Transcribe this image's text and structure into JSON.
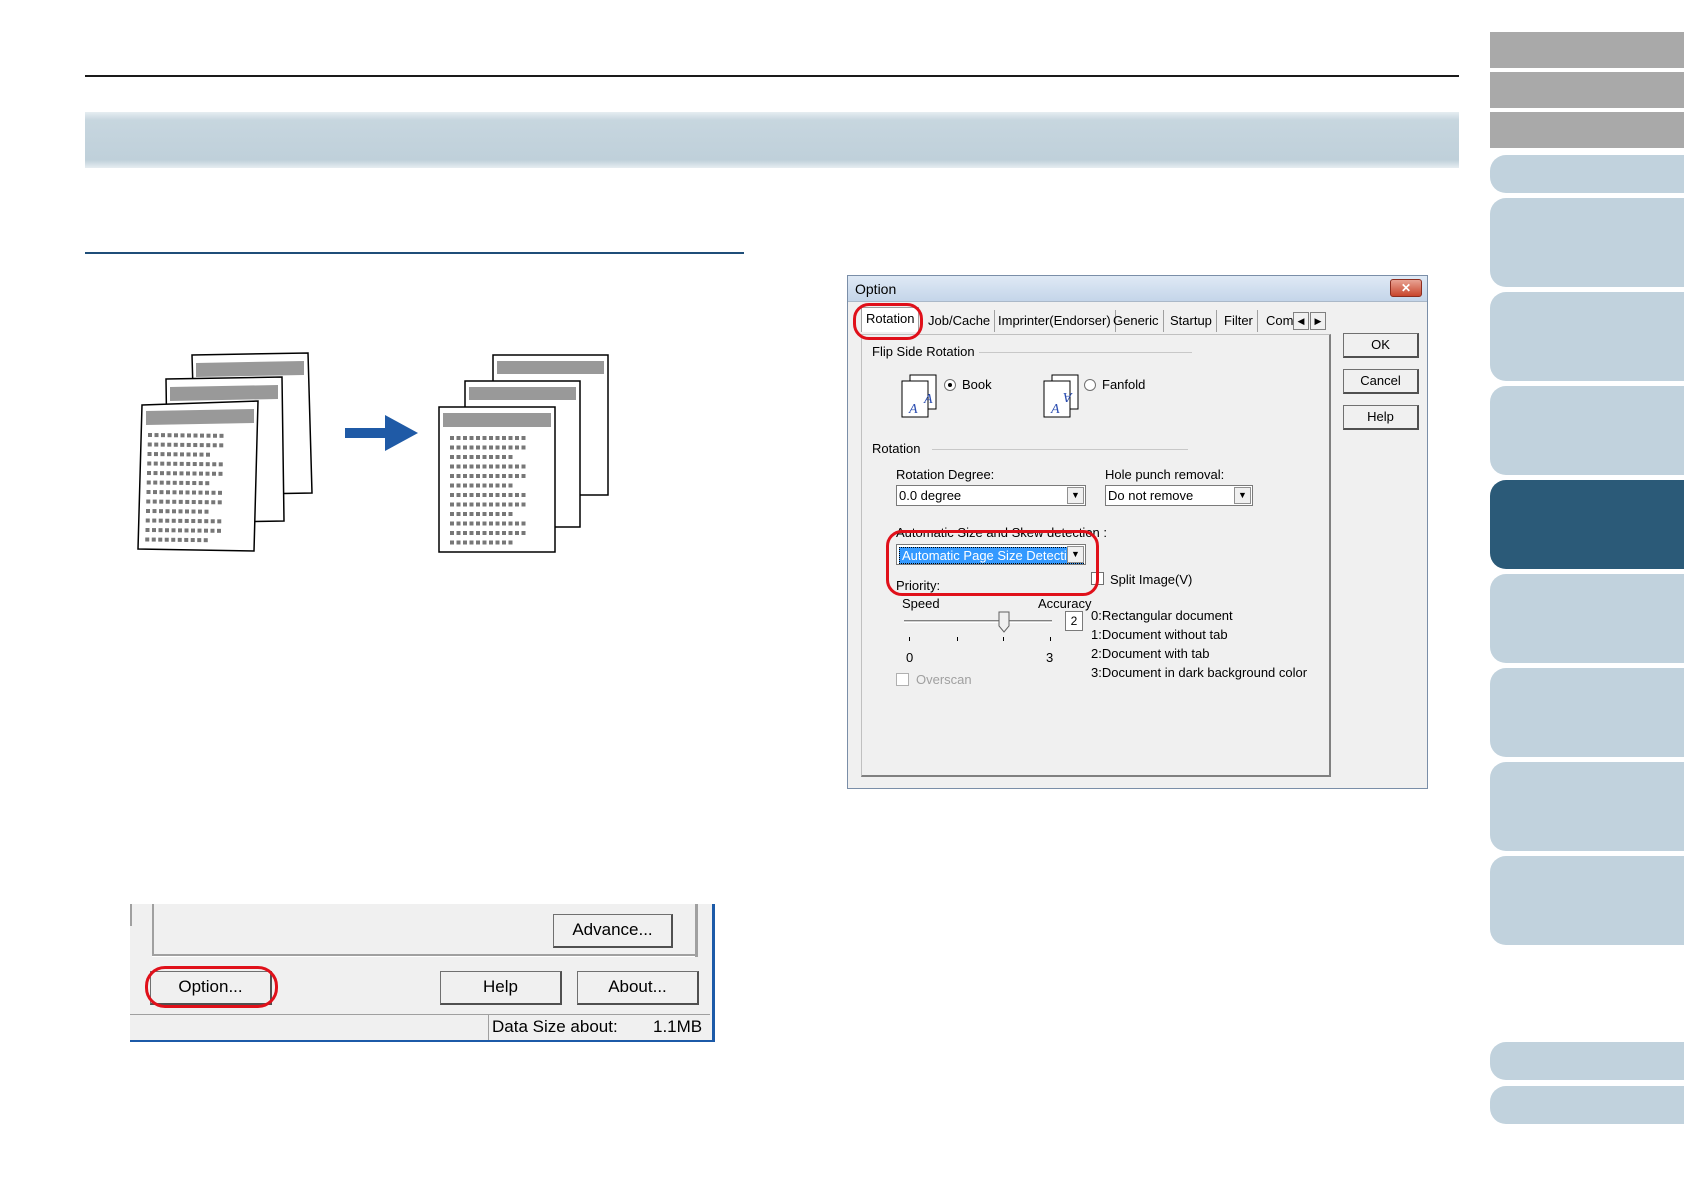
{
  "option_dialog": {
    "title": "Option",
    "close_glyph": "✕",
    "tabs": [
      "Rotation",
      "Job/Cache",
      "Imprinter(Endorser)",
      "Generic",
      "Startup",
      "Filter",
      "Compr"
    ],
    "tab_scroll_left": "◀",
    "tab_scroll_right": "▶",
    "flip_side": {
      "group_label": "Flip Side Rotation",
      "book_label": "Book",
      "fanfold_label": "Fanfold",
      "selected": "Book"
    },
    "rotation": {
      "group_label": "Rotation",
      "degree_label": "Rotation Degree:",
      "degree_value": "0.0 degree",
      "hole_punch_label": "Hole punch removal:",
      "hole_punch_value": "Do not remove",
      "auto_label": "Automatic Size and Skew detection :",
      "auto_value": "Automatic Page Size Detection",
      "priority_label": "Priority:",
      "speed_label": "Speed",
      "accuracy_label": "Accuracy",
      "slider_min": "0",
      "slider_max": "3",
      "slider_value": "2",
      "split_image_label": "Split Image(V)",
      "overscan_label": "Overscan",
      "doc_types": [
        "0:Rectangular document",
        "1:Document without tab",
        "2:Document with tab",
        "3:Document in dark background color"
      ]
    },
    "buttons": {
      "ok": "OK",
      "cancel": "Cancel",
      "help": "Help"
    },
    "dropdown_glyph": "▼"
  },
  "main_dialog_crop": {
    "advance_label": "Advance...",
    "option_label": "Option...",
    "help_label": "Help",
    "about_label": "About...",
    "data_size_label": "Data Size about:",
    "data_size_value": "1.1MB"
  },
  "colors": {
    "highlight_red": "#e0101a",
    "arrow_blue": "#1f5aa6",
    "tab_light": "#c1d2dd",
    "tab_dark": "#2b5a78",
    "title_band": "#c7d6df"
  }
}
